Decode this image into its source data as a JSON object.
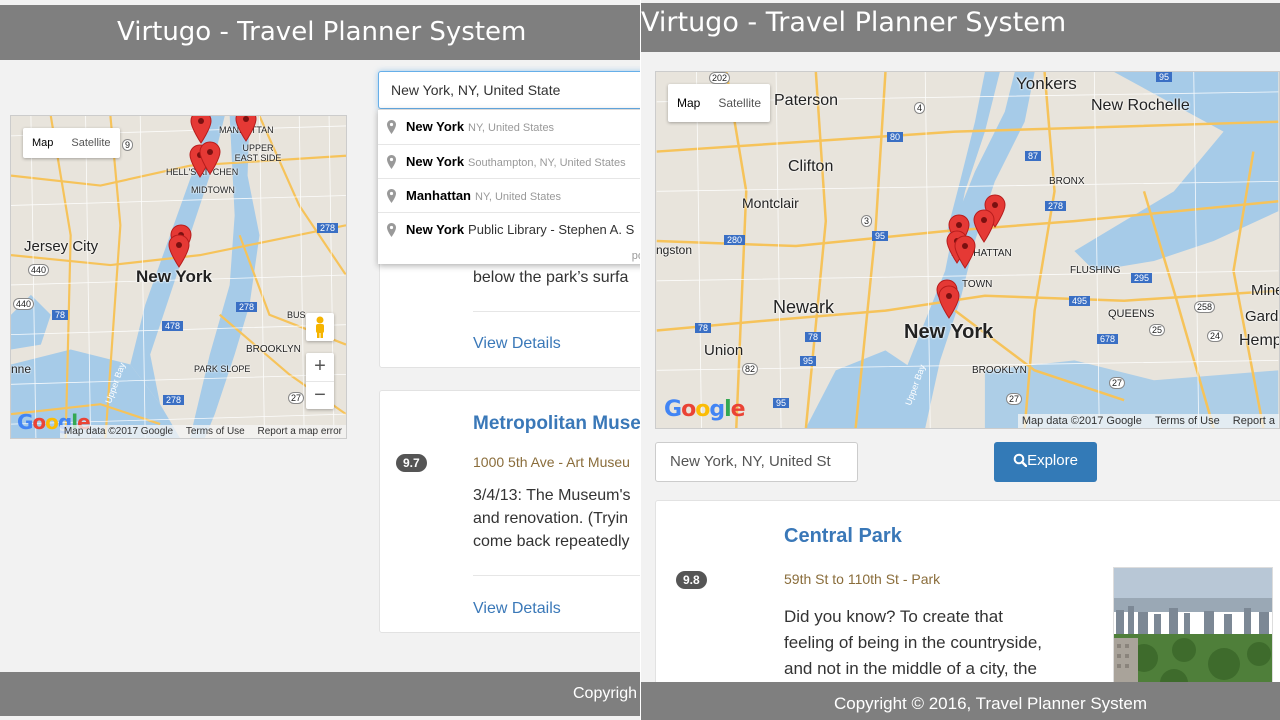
{
  "app": {
    "title": "Virtugo - Travel Planner System",
    "footer_left": "Copyrigh",
    "footer_right": "Copyright © 2016, Travel Planner System"
  },
  "colors": {
    "header_bg": "#7f7f7f",
    "link": "#3a78b8",
    "button": "#337ab7",
    "pin": "#e53935",
    "water": "#a6cbe8"
  },
  "left": {
    "map": {
      "type_map": "Map",
      "type_satellite": "Satellite",
      "labels": {
        "jersey_city": "Jersey City",
        "new_york": "New York",
        "midtown": "MIDTOWN",
        "hells_kitchen": "HELL'S KITCHEN",
        "manhattan": "MANHATTAN",
        "upper_east_side": "UPPER EAST SIDE",
        "brooklyn": "BROOKLYN",
        "park_slope": "PARK SLOPE",
        "upper_bay": "Upper Bay",
        "nne": "nne",
        "bus": "BUS"
      },
      "shields": [
        "9",
        "440",
        "440",
        "78",
        "478",
        "278",
        "278",
        "278",
        "27"
      ],
      "attribution": {
        "data": "Map data ©2017 Google",
        "terms": "Terms of Use",
        "report": "Report a map error"
      },
      "logo": "Google",
      "zoom_in": "+",
      "zoom_out": "−"
    },
    "search": {
      "value": "New York, NY, United State"
    },
    "autocomplete": {
      "items": [
        {
          "main": "New York",
          "secondary": "NY, United States"
        },
        {
          "main": "New York",
          "secondary": "Southampton, NY, United States"
        },
        {
          "main": "Manhattan",
          "secondary": "NY, United States"
        },
        {
          "main": "New York",
          "secondary": "Public Library - Stephen A. S"
        }
      ],
      "powered": "po"
    },
    "card1": {
      "body": "below the park’s surfa",
      "link": "View Details"
    },
    "card2": {
      "title": "Metropolitan Muse",
      "rating": "9.7",
      "subtitle": "1000 5th Ave - Art Museu",
      "body_lines": [
        "3/4/13: The Museum's",
        "and renovation. (Tryin",
        "come back repeatedly"
      ],
      "link": "View Details"
    }
  },
  "right": {
    "map": {
      "type_map": "Map",
      "type_satellite": "Satellite",
      "labels": {
        "yonkers": "Yonkers",
        "new_rochelle": "New Rochelle",
        "paterson": "Paterson",
        "clifton": "Clifton",
        "montclair": "Montclair",
        "bronx": "BRONX",
        "ngston": "ngston",
        "newark": "Newark",
        "new_york": "New York",
        "union": "Union",
        "manhattan": "MANHATTAN",
        "midtown": "TOWN",
        "flushing": "FLUSHING",
        "queens": "QUEENS",
        "mineo": "Mineo",
        "garden": "Garden",
        "hemp": "Hemp",
        "brooklyn": "BROOKLYN",
        "upper_bay": "Upper Bay"
      },
      "shields": [
        "202",
        "95",
        "4",
        "80",
        "87",
        "278",
        "3",
        "95",
        "280",
        "295",
        "495",
        "258",
        "25",
        "24",
        "78",
        "78",
        "678",
        "82",
        "95",
        "27",
        "27",
        "95"
      ],
      "attribution": {
        "data": "Map data ©2017 Google",
        "terms": "Terms of Use",
        "report": "Report a"
      },
      "logo": "Google"
    },
    "search": {
      "value": "New York, NY, United St"
    },
    "explore_label": "Explore",
    "card": {
      "title": "Central Park",
      "rating": "9.8",
      "subtitle": "59th St to 110th St - Park",
      "body_lines": [
        "Did you know? To create that",
        "feeling of being in the countryside,",
        "and not in the middle of a city, the"
      ]
    }
  }
}
